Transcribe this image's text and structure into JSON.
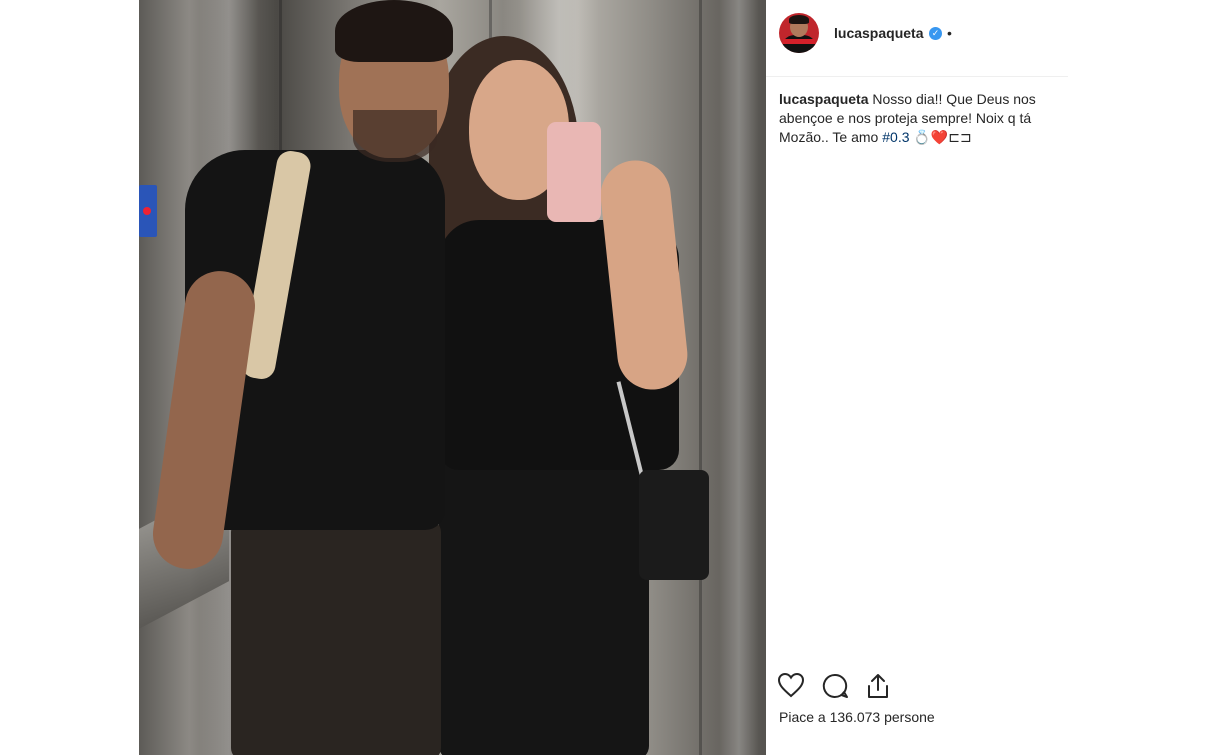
{
  "post": {
    "username": "lucaspaqueta",
    "verified_icon": "verified-badge-icon",
    "header_separator": "•",
    "caption": {
      "user": "lucaspaqueta",
      "text_before_tag": " Nosso dia!! Que Deus nos abençoe e nos proteja sempre! Noix q tá Mozão.. Te amo ",
      "hashtag": "#0.3",
      "text_after_tag": " 💍❤️⊏⊐"
    },
    "likes_text": "Piace a 136.073 persone"
  },
  "actions": {
    "like_icon": "heart-icon",
    "comment_icon": "comment-icon",
    "share_icon": "share-icon"
  },
  "colors": {
    "verified": "#3897f0",
    "hashtag": "#003569",
    "text": "#262626",
    "divider": "#efefef"
  }
}
